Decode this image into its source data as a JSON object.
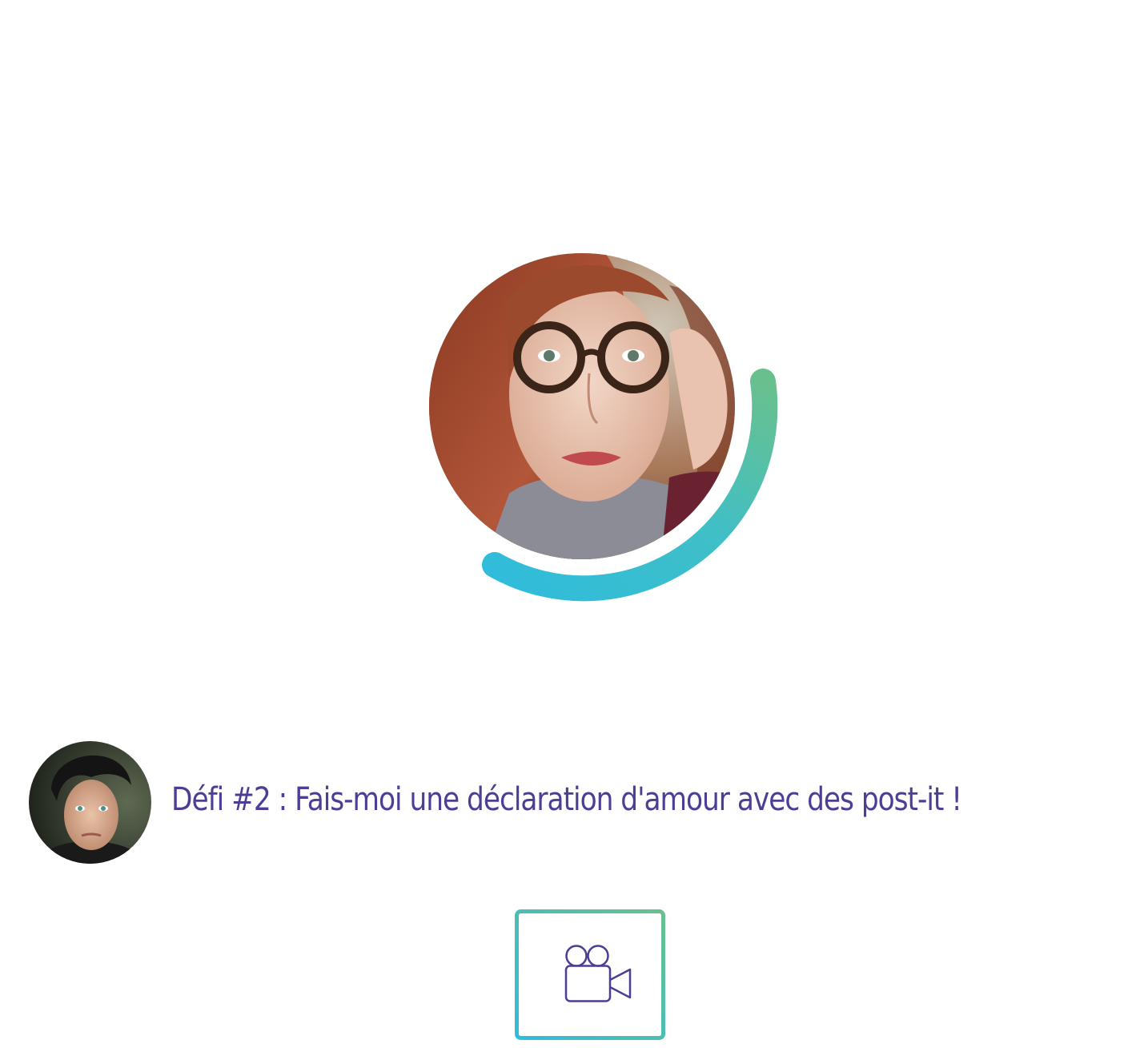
{
  "profile": {
    "name_icon": "woman-with-glasses-photo",
    "progress": 0.45,
    "ring_gradient": [
      "#2fbcdc",
      "#69c08e"
    ]
  },
  "challenge": {
    "avatar_icon": "young-man-photo",
    "text": "Défi #2 : Fais-moi une déclaration d'amour avec des post-it !",
    "text_color": "#4a3f95"
  },
  "video_button": {
    "icon": "video-camera-icon",
    "border_gradient": [
      "#2fbcdc",
      "#69c08e"
    ],
    "icon_color": "#4a3f95"
  }
}
